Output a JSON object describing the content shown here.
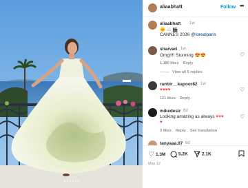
{
  "post": {
    "author": "aliaabhatt",
    "follow_label": "Follow",
    "more_glyph": "•••",
    "photo_alt": "Woman in floral gown on a balcony overlooking the sea",
    "carousel_dots": 6
  },
  "caption": {
    "user": "aliaabhatt",
    "time": "1w",
    "emoji": "🌞☁️🎬",
    "text_prefix": "CANNES 2026 ",
    "tag": "@lorealparis"
  },
  "comments": [
    {
      "user": "sharvari",
      "time": "1w",
      "text": "Omg!!!! Stunning ",
      "hearts": "😍😍",
      "likes": "1,180 likes",
      "reply": "Reply",
      "view_replies": "View all 5 replies",
      "avatar_color": "#7a5a48"
    },
    {
      "user": "ranbir__kapoor82",
      "time": "1w",
      "hearts": "♥♥♥♥",
      "likes": "121 likes",
      "reply": "Reply",
      "avatar_color": "#3a3a3a"
    },
    {
      "user": "mikedesir",
      "time": "6d",
      "text": "Looking amazing as always ",
      "hearts": "♥♥♥",
      "heart_wrap": "♥",
      "likes": "3 likes",
      "reply": "Reply",
      "see_translation": "See translation",
      "avatar_color": "#1c1c1c"
    },
    {
      "user": "tanyaaa.07",
      "time": "6d",
      "avatar_color": "#c99a7a"
    }
  ],
  "actions": {
    "likes": "1.3M",
    "comments": "5.2K",
    "shares": "2.1K",
    "date": "May 12"
  },
  "colors": {
    "link": "#0095f6",
    "heart": "#ed4956",
    "muted": "#8e8e8e"
  },
  "icons": [
    "heart-icon",
    "comment-icon",
    "share-icon",
    "bookmark-icon",
    "more-icon"
  ]
}
